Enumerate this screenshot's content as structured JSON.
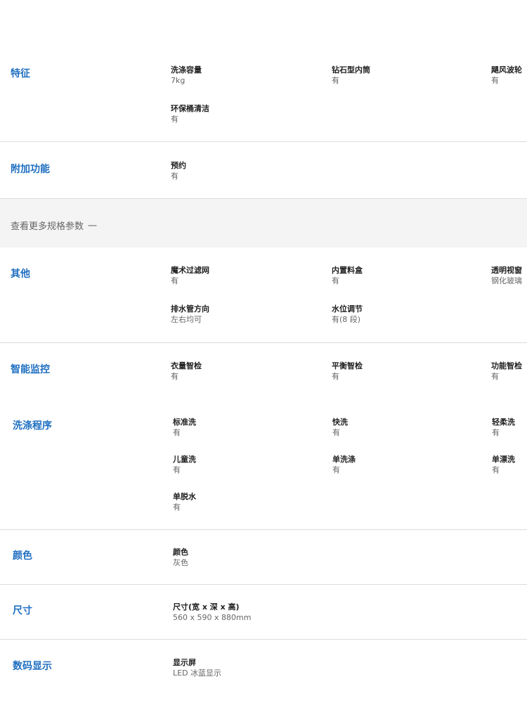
{
  "sections": {
    "features": {
      "title": "特征",
      "items": [
        {
          "label": "洗涤容量",
          "value": "7kg"
        },
        {
          "label": "钻石型内筒",
          "value": "有"
        },
        {
          "label": "飓风波轮",
          "value": "有"
        },
        {
          "label": "环保桶清洁",
          "value": "有"
        }
      ]
    },
    "extra": {
      "title": "附加功能",
      "items": [
        {
          "label": "预约",
          "value": "有"
        }
      ]
    },
    "more": {
      "label": "查看更多规格参数",
      "toggle": "一"
    },
    "other": {
      "title": "其他",
      "items": [
        {
          "label": "魔术过滤网",
          "value": "有"
        },
        {
          "label": "内置料盒",
          "value": "有"
        },
        {
          "label": "透明视窗",
          "value": "钢化玻璃"
        },
        {
          "label": "排水管方向",
          "value": "左右均可"
        },
        {
          "label": "水位调节",
          "value": "有(8 段)"
        }
      ]
    },
    "smart": {
      "title": "智能监控",
      "items": [
        {
          "label": "衣量智检",
          "value": "有"
        },
        {
          "label": "平衡智检",
          "value": "有"
        },
        {
          "label": "功能智检",
          "value": "有"
        }
      ]
    },
    "programs": {
      "title": "洗涤程序",
      "items": [
        {
          "label": "标准洗",
          "value": "有"
        },
        {
          "label": "快洗",
          "value": "有"
        },
        {
          "label": "轻柔洗",
          "value": "有"
        },
        {
          "label": "儿童洗",
          "value": "有"
        },
        {
          "label": "单洗涤",
          "value": "有"
        },
        {
          "label": "单漂洗",
          "value": "有"
        },
        {
          "label": "单脱水",
          "value": "有"
        }
      ]
    },
    "color": {
      "title": "颜色",
      "items": [
        {
          "label": "颜色",
          "value": "灰色"
        }
      ]
    },
    "size": {
      "title": "尺寸",
      "items": [
        {
          "label": "尺寸(宽 x 深 x 高)",
          "value": "560 x 590 x 880mm"
        }
      ]
    },
    "display": {
      "title": "数码显示",
      "items": [
        {
          "label": "显示屏",
          "value": "LED 冰蓝显示"
        }
      ]
    }
  }
}
